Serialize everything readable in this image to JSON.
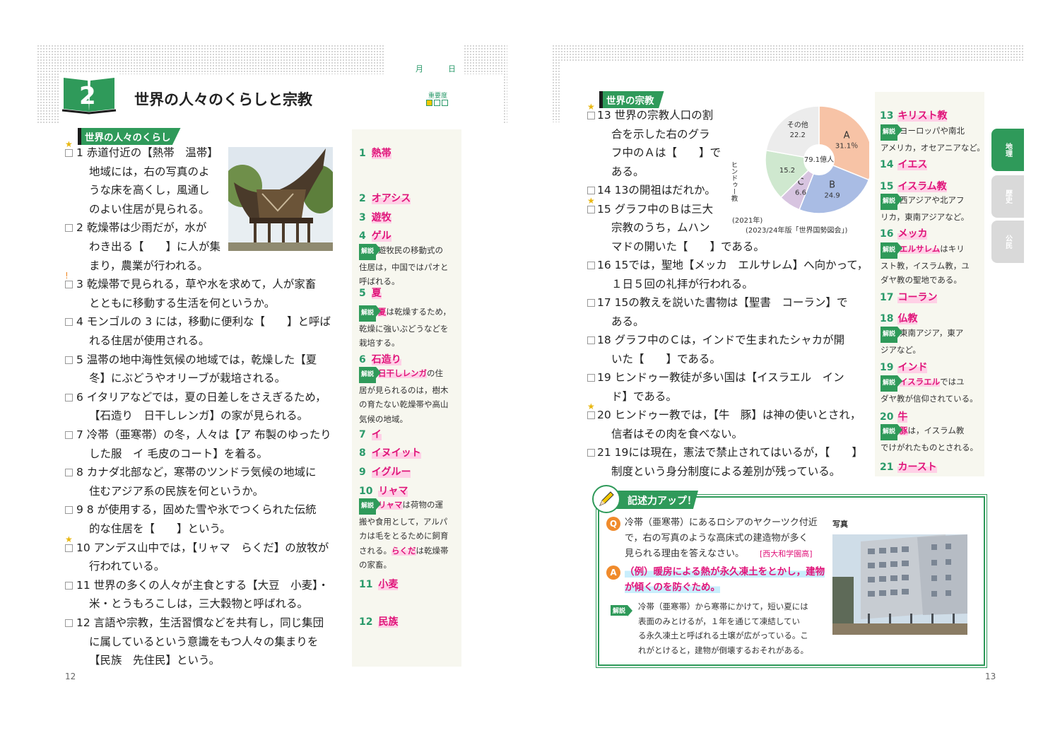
{
  "left": {
    "month_label": "月",
    "day_label": "日",
    "chapter_number": "2",
    "chapter_title": "世界の人々のくらしと宗教",
    "importance_label": "重要度",
    "section_title": "世界の人々のくらし",
    "page_number": "12",
    "lines": [
      "1 赤道付近の【熱帯　温帯】",
      "地域には，右の写真のよ",
      "うな床を高くし，風通し",
      "のよい住居が見られる。",
      "2 乾燥帯は少雨だが，水が",
      "わき出る【　　】に人が集",
      "まり，農業が行われる。",
      "3 乾燥帯で見られる，草や水を求めて，人が家畜",
      "とともに移動する生活を何というか。",
      "4 モンゴルの 3 には，移動に便利な【　　】と呼ば",
      "れる住居が使用される。",
      "5 温帯の地中海性気候の地域では，乾燥した【夏",
      "冬】にぶどうやオリーブが栽培される。",
      "6 イタリアなどでは，夏の日差しをさえぎるため，",
      "【石造り　日干しレンガ】の家が見られる。",
      "7 冷帯（亜寒帯）の冬，人々は【ア 布製のゆったり",
      "した服　イ 毛皮のコート】を着る。",
      "8 カナダ北部など，寒帯のツンドラ気候の地域に",
      "住むアジア系の民族を何というか。",
      "9 8 が使用する，固めた雪や氷でつくられた伝統",
      "的な住居を【　　】という。",
      "10 アンデス山中では，【リャマ　らくだ】の放牧が",
      "行われている。",
      "11 世界の多くの人々が主食とする【大豆　小麦】・",
      "米・とうもろこしは，三大穀物と呼ばれる。",
      "12 言語や宗教，生活習慣などを共有し，同じ集団",
      "に属しているという意識をもつ人々の集まりを",
      "【民族　先住民】という。"
    ],
    "answers": [
      {
        "n": "1",
        "a": "熱帯"
      },
      {
        "n": "2",
        "a": "オアシス"
      },
      {
        "n": "3",
        "a": "遊牧"
      },
      {
        "n": "4",
        "a": "ゲル"
      },
      {
        "n": "5",
        "a": "夏"
      },
      {
        "n": "6",
        "a": "石造り"
      },
      {
        "n": "7",
        "a": "イ"
      },
      {
        "n": "8",
        "a": "イヌイット"
      },
      {
        "n": "9",
        "a": "イグルー"
      },
      {
        "n": "10",
        "a": "リャマ"
      },
      {
        "n": "11",
        "a": "小麦"
      },
      {
        "n": "12",
        "a": "民族"
      }
    ],
    "kaisetsu_label": "解説",
    "notes": {
      "n4": [
        "遊牧民の移動式の",
        "住居は，中国ではパオと",
        "呼ばれる。"
      ],
      "n5": [
        "は乾燥するため，",
        "乾燥に強いぶどうなどを",
        "栽培する。"
      ],
      "n5_hl": "夏",
      "n6_hl": "日干しレンガ",
      "n6": [
        "の住",
        "居が見られるのは，樹木",
        "の育たない乾燥帯や高山",
        "気候の地域。"
      ],
      "n10_hl": "リャマ",
      "n10": [
        "は荷物の運",
        "搬や食用として，アルパ",
        "カは毛をとるために飼育",
        "される。",
        "は乾燥帯",
        "の家畜。"
      ],
      "n10_hl2": "らくだ"
    }
  },
  "right": {
    "section_title": "世界の宗教",
    "page_number": "13",
    "lines": [
      "13 世界の宗教人口の割",
      "合を示した右のグラ",
      "フ中のＡは【　　】で",
      "ある。",
      "14 13の開祖はだれか。",
      "15 グラフ中のＢは三大",
      "宗教のうち，ムハン",
      "マドの開いた【　　】である。",
      "16 15では，聖地【メッカ　エルサレム】へ向かって，",
      "１日５回の礼拝が行われる。",
      "17 15の教えを説いた書物は【聖書　コーラン】で",
      "ある。",
      "18 グラフ中のＣは，インドで生まれたシャカが開",
      "いた【　　】である。",
      "19 ヒンドゥー教徒が多い国は【イスラエル　イン",
      "ド】である。",
      "20 ヒンドゥー教では，【牛　豚】は神の使いとされ，",
      "信者はその肉を食べない。",
      "21 19には現在，憲法で禁止されてはいるが，【　　】",
      "制度という身分制度による差別が残っている。"
    ],
    "answers": [
      {
        "n": "13",
        "a": "キリスト教"
      },
      {
        "n": "14",
        "a": "イエス"
      },
      {
        "n": "15",
        "a": "イスラム教"
      },
      {
        "n": "16",
        "a": "メッカ"
      },
      {
        "n": "17",
        "a": "コーラン"
      },
      {
        "n": "18",
        "a": "仏教"
      },
      {
        "n": "19",
        "a": "インド"
      },
      {
        "n": "20",
        "a": "牛"
      },
      {
        "n": "21",
        "a": "カースト"
      }
    ],
    "notes": {
      "n13": [
        "ヨーロッパや南北",
        "アメリカ，オセアニアなど。"
      ],
      "n15": [
        "西アジアや北アフ",
        "リカ，東南アジアなど。"
      ],
      "n16_hl": "エルサレム",
      "n16": [
        "はキリ",
        "スト教，イスラム教，ユ",
        "ダヤ教の聖地である。"
      ],
      "n18": [
        "東南アジア，東ア",
        "ジアなど。"
      ],
      "n19_hl": "イスラエル",
      "n19": [
        "ではユ",
        "ダヤ教が信仰されている。"
      ],
      "n20_hl": "豚",
      "n20": [
        "は，イスラム教",
        "でけがれたものとされる。"
      ]
    },
    "chart_source": "(2023/24年版「世界国勢図会」)",
    "chart_year": "(2021年)",
    "tabs": [
      "地理",
      "歴史",
      "公民"
    ],
    "writeup": {
      "title": "記述力アップ！",
      "q_lines": [
        "冷帯（亜寒帯）にあるロシアのヤクーツク付近",
        "で，右の写真のような高床式の建造物が多く",
        "見られる理由を答えなさい。"
      ],
      "q_source": "[西大和学園高]",
      "photo_label": "写真",
      "a_lines": [
        "（例）暖房による熱が永久凍土をとかし，建物",
        "が傾くのを防ぐため。"
      ],
      "k_lines": [
        "冷帯（亜寒帯）から寒帯にかけて，短い夏には",
        "表面のみとけるが，１年を通じて凍結してい",
        "る永久凍土と呼ばれる土壌が広がっている。こ",
        "れがとけると，建物が倒壊するおそれがある。"
      ]
    }
  },
  "chart_data": {
    "type": "pie",
    "title": "",
    "center_label": "79.1億人",
    "labels": [
      "A",
      "B",
      "C",
      "ヒンドゥー教",
      "その他"
    ],
    "values": [
      31.1,
      24.9,
      6.6,
      15.2,
      22.2
    ],
    "value_labels": [
      "31.1％",
      "24.9",
      "6.6",
      "15.2",
      "22.2"
    ],
    "colors": [
      "#f7c3a6",
      "#a9bce4",
      "#d7c4e0",
      "#cfe8cf",
      "#ececec"
    ]
  }
}
